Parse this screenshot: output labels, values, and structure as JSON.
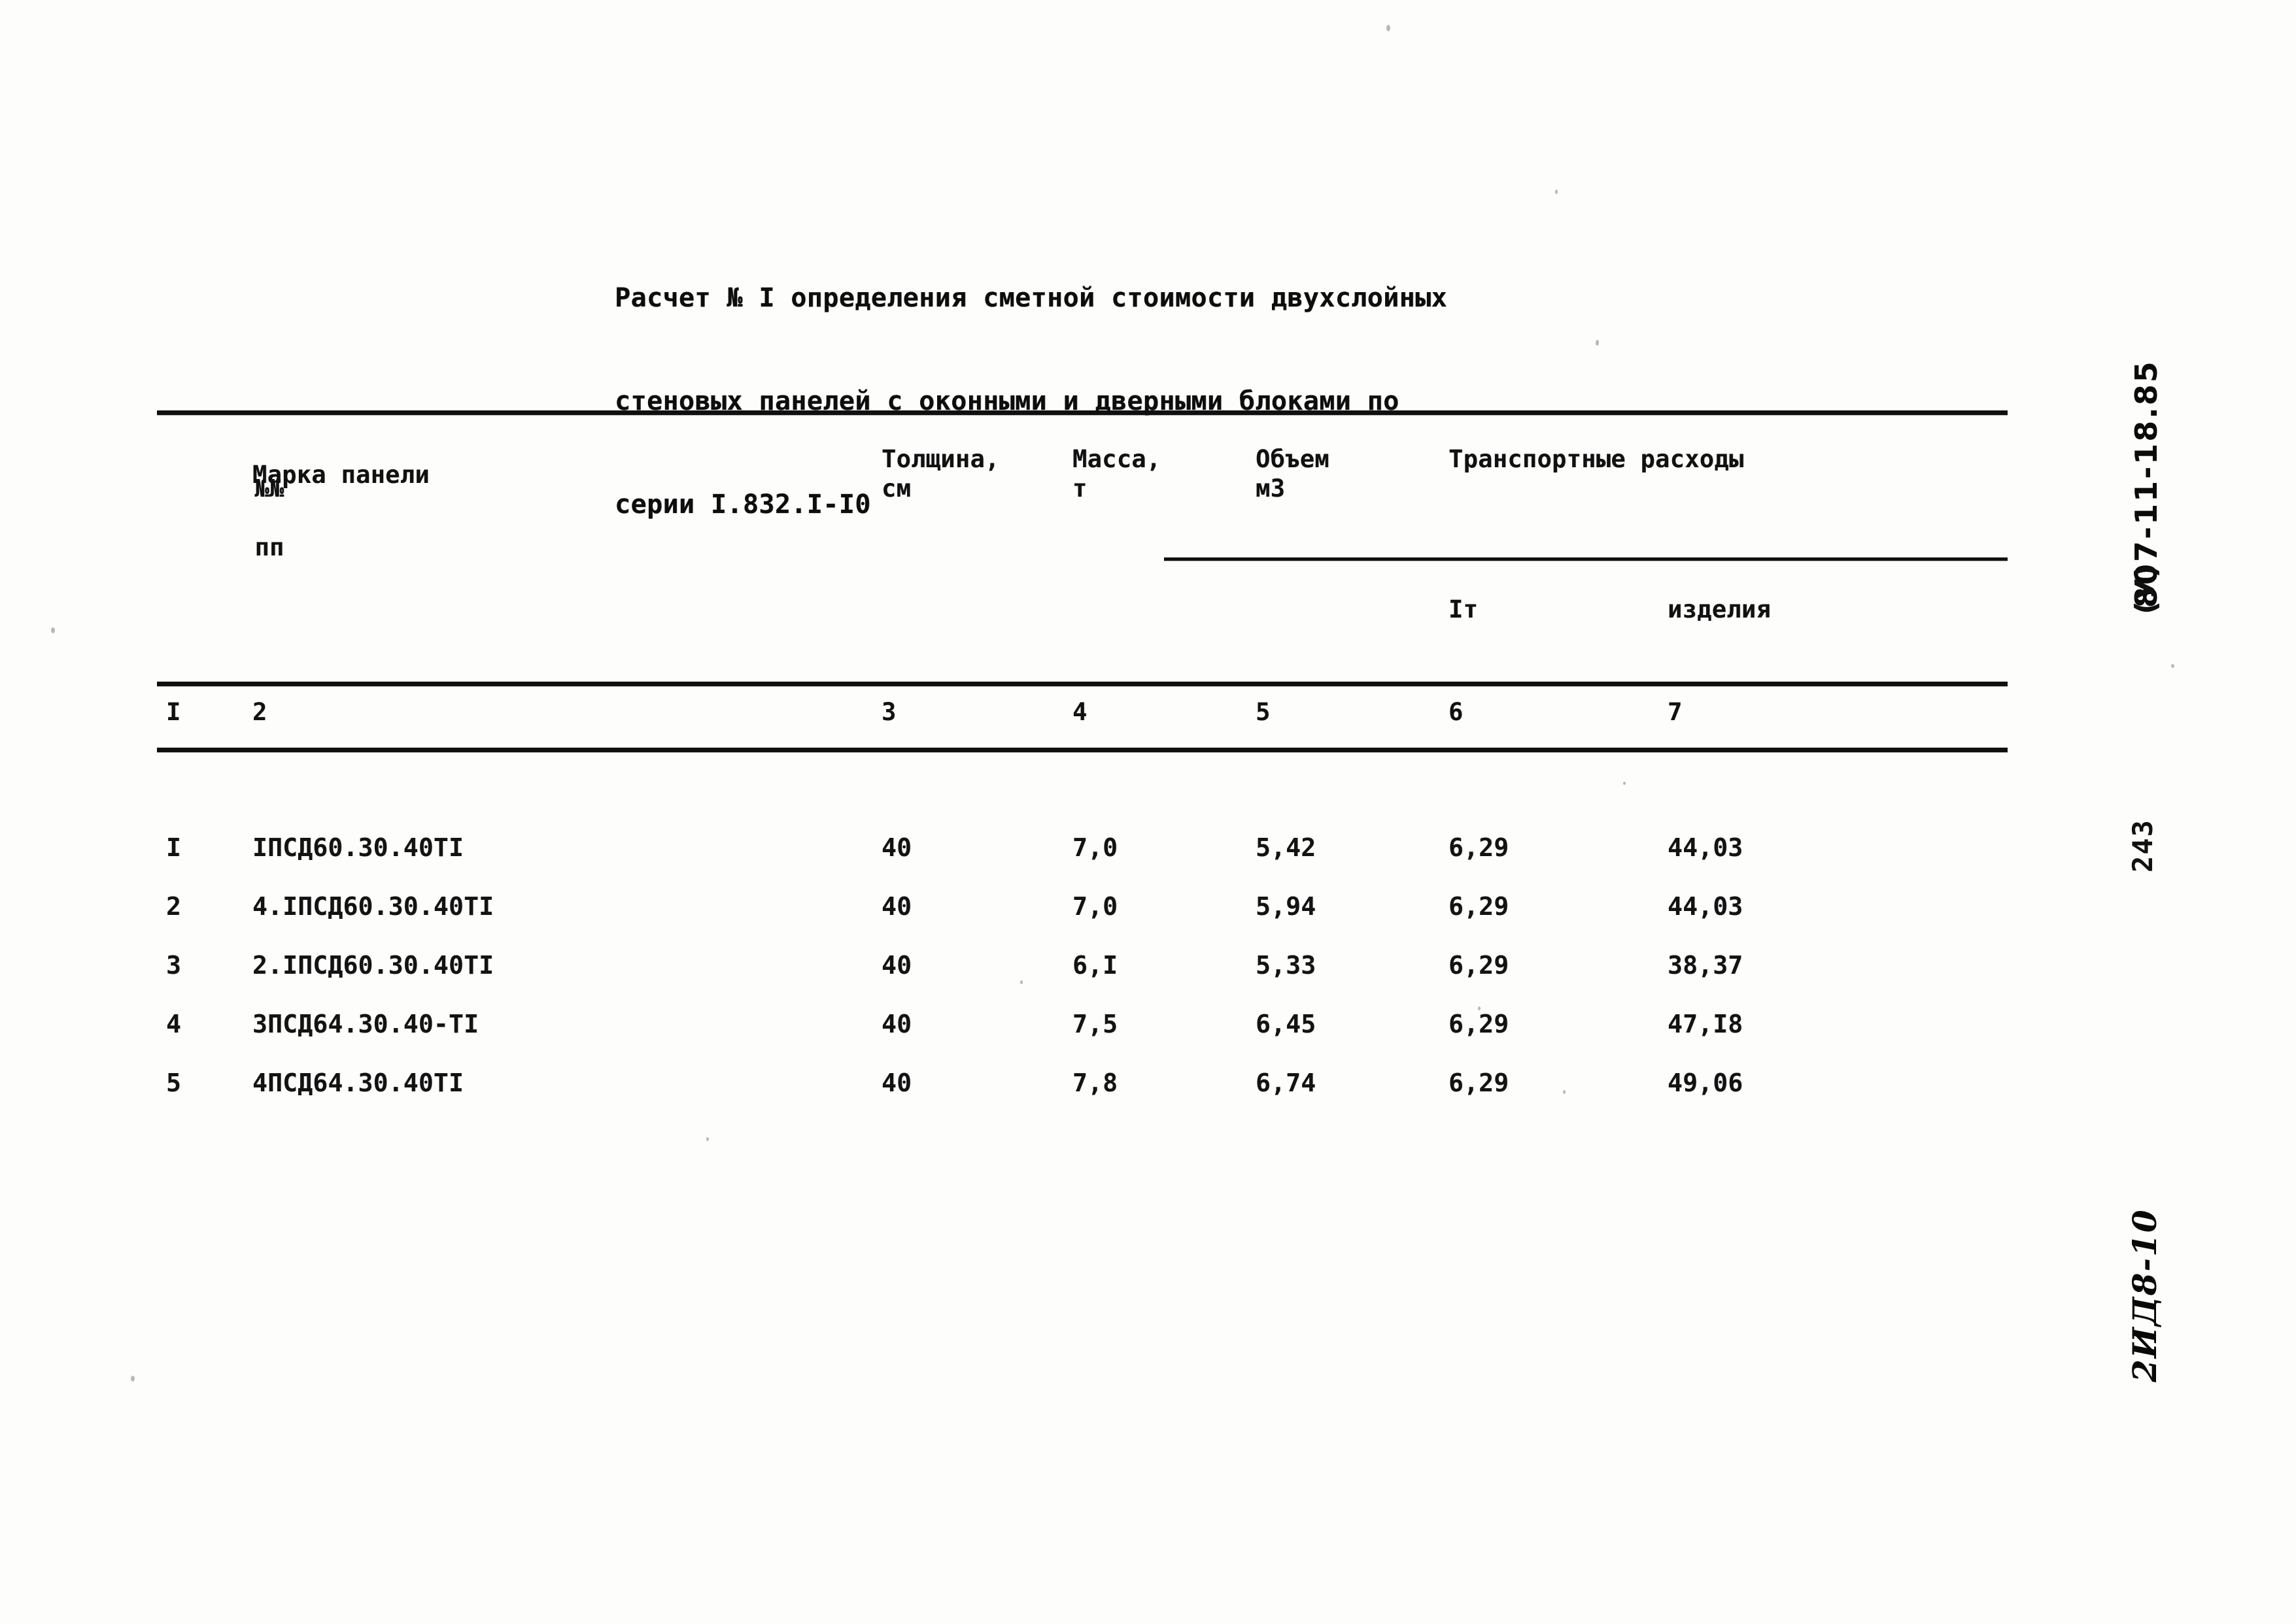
{
  "document": {
    "title_lines": [
      "Расчет № I определения сметной стоимости двухслойных",
      "стеновых панелей с оконными и дверными блоками по",
      "серии I.832.I-I0"
    ]
  },
  "table": {
    "header": {
      "no_line1": "№№",
      "no_line2": "пп",
      "mark": "Марка панели",
      "thickness": "Толщина,\nсм",
      "mass": "Масса,\nт",
      "volume": "Объем\nм3",
      "transport_group": "Транспортные расходы",
      "transport_per_t": "Iт",
      "transport_per_item": "изделия"
    },
    "column_numbers": [
      "I",
      "2",
      "3",
      "4",
      "5",
      "6",
      "7"
    ],
    "rows": [
      {
        "no": "I",
        "mark": "IПСД60.30.40TI",
        "thickness": "40",
        "mass": "7,0",
        "volume": "5,42",
        "transport_t": "6,29",
        "transport_item": "44,03"
      },
      {
        "no": "2",
        "mark": "4.IПСД60.30.40TI",
        "thickness": "40",
        "mass": "7,0",
        "volume": "5,94",
        "transport_t": "6,29",
        "transport_item": "44,03"
      },
      {
        "no": "3",
        "mark": "2.IПСД60.30.40TI",
        "thickness": "40",
        "mass": "6,I",
        "volume": "5,33",
        "transport_t": "6,29",
        "transport_item": "38,37"
      },
      {
        "no": "4",
        "mark": "3ПСД64.30.40-TI",
        "thickness": "40",
        "mass": "7,5",
        "volume": "6,45",
        "transport_t": "6,29",
        "transport_item": "47,I8"
      },
      {
        "no": "5",
        "mark": "4ПСД64.30.40TI",
        "thickness": "40",
        "mass": "7,8",
        "volume": "6,74",
        "transport_t": "6,29",
        "transport_item": "49,06"
      }
    ]
  },
  "margin": {
    "archive_code": "807-11-18.85",
    "revision_mark": "(У)",
    "page_number": "243",
    "handwritten_code": "2ИД8-10"
  },
  "colors": {
    "ink": "#111111",
    "paper": "#fdfdfb"
  }
}
